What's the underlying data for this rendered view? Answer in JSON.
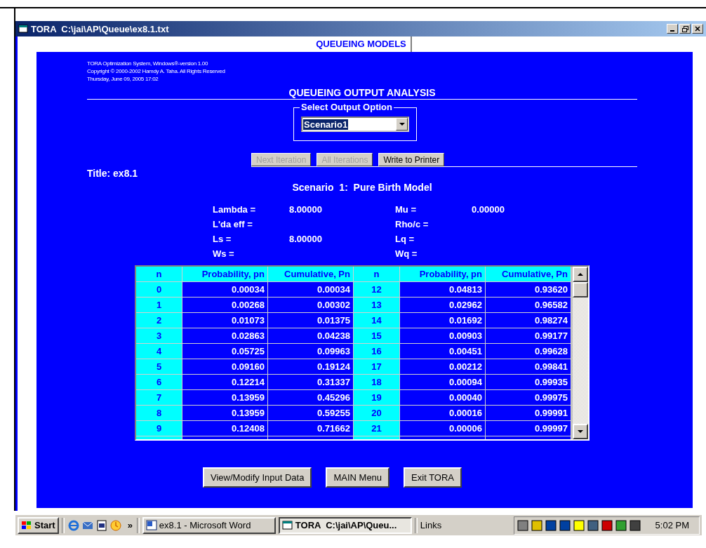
{
  "window": {
    "title": "TORA  C:\\jai\\AP\\Queue\\ex8.1.txt"
  },
  "header_tab": "QUEUEING MODELS",
  "info_lines": [
    "TORA Optimization System, Windows®-version 1.00",
    "Copyright © 2000-2002 Hamdy A. Taha.  All Rights Reserved",
    "Thursday, June 09, 2005 17:02"
  ],
  "heading": "QUEUEING OUTPUT ANALYSIS",
  "output_option": {
    "label": "Select Output Option",
    "value": "Scenario1"
  },
  "action_buttons": [
    {
      "label": "Next Iteration",
      "disabled": true
    },
    {
      "label": "All Iterations",
      "disabled": true
    },
    {
      "label": "Write to Printer",
      "disabled": false
    }
  ],
  "title": "Title: ex8.1",
  "scenario": "Scenario  1:  Pure Birth Model",
  "metrics": [
    {
      "label": "Lambda =",
      "value": "8.00000"
    },
    {
      "label": "Mu =",
      "value": "0.00000"
    },
    {
      "label": "L'da eff ="
    },
    {
      "label": "Rho/c ="
    },
    {
      "label": "Ls =",
      "value": "8.00000"
    },
    {
      "label": "Lq ="
    },
    {
      "label": "Ws ="
    },
    {
      "label": "Wq ="
    }
  ],
  "table": {
    "columns": [
      "n",
      "Probability, pn",
      "Cumulative, Pn",
      "n",
      "Probability, pn",
      "Cumulative, Pn"
    ],
    "rows": [
      [
        "0",
        "0.00034",
        "0.00034",
        "12",
        "0.04813",
        "0.93620"
      ],
      [
        "1",
        "0.00268",
        "0.00302",
        "13",
        "0.02962",
        "0.96582"
      ],
      [
        "2",
        "0.01073",
        "0.01375",
        "14",
        "0.01692",
        "0.98274"
      ],
      [
        "3",
        "0.02863",
        "0.04238",
        "15",
        "0.00903",
        "0.99177"
      ],
      [
        "4",
        "0.05725",
        "0.09963",
        "16",
        "0.00451",
        "0.99628"
      ],
      [
        "5",
        "0.09160",
        "0.19124",
        "17",
        "0.00212",
        "0.99841"
      ],
      [
        "6",
        "0.12214",
        "0.31337",
        "18",
        "0.00094",
        "0.99935"
      ],
      [
        "7",
        "0.13959",
        "0.45296",
        "19",
        "0.00040",
        "0.99975"
      ],
      [
        "8",
        "0.13959",
        "0.59255",
        "20",
        "0.00016",
        "0.99991"
      ],
      [
        "9",
        "0.12408",
        "0.71662",
        "21",
        "0.00006",
        "0.99997"
      ]
    ]
  },
  "bottom_buttons": [
    "View/Modify Input Data",
    "MAIN Menu",
    "Exit TORA"
  ],
  "taskbar": {
    "start": "Start",
    "more": "»",
    "tasks": [
      {
        "label": "ex8.1 - Microsoft Word",
        "selected": false
      },
      {
        "label": "TORA  C:\\jai\\AP\\Queu...",
        "selected": true
      }
    ],
    "links": "Links",
    "clock": "5:02 PM"
  }
}
